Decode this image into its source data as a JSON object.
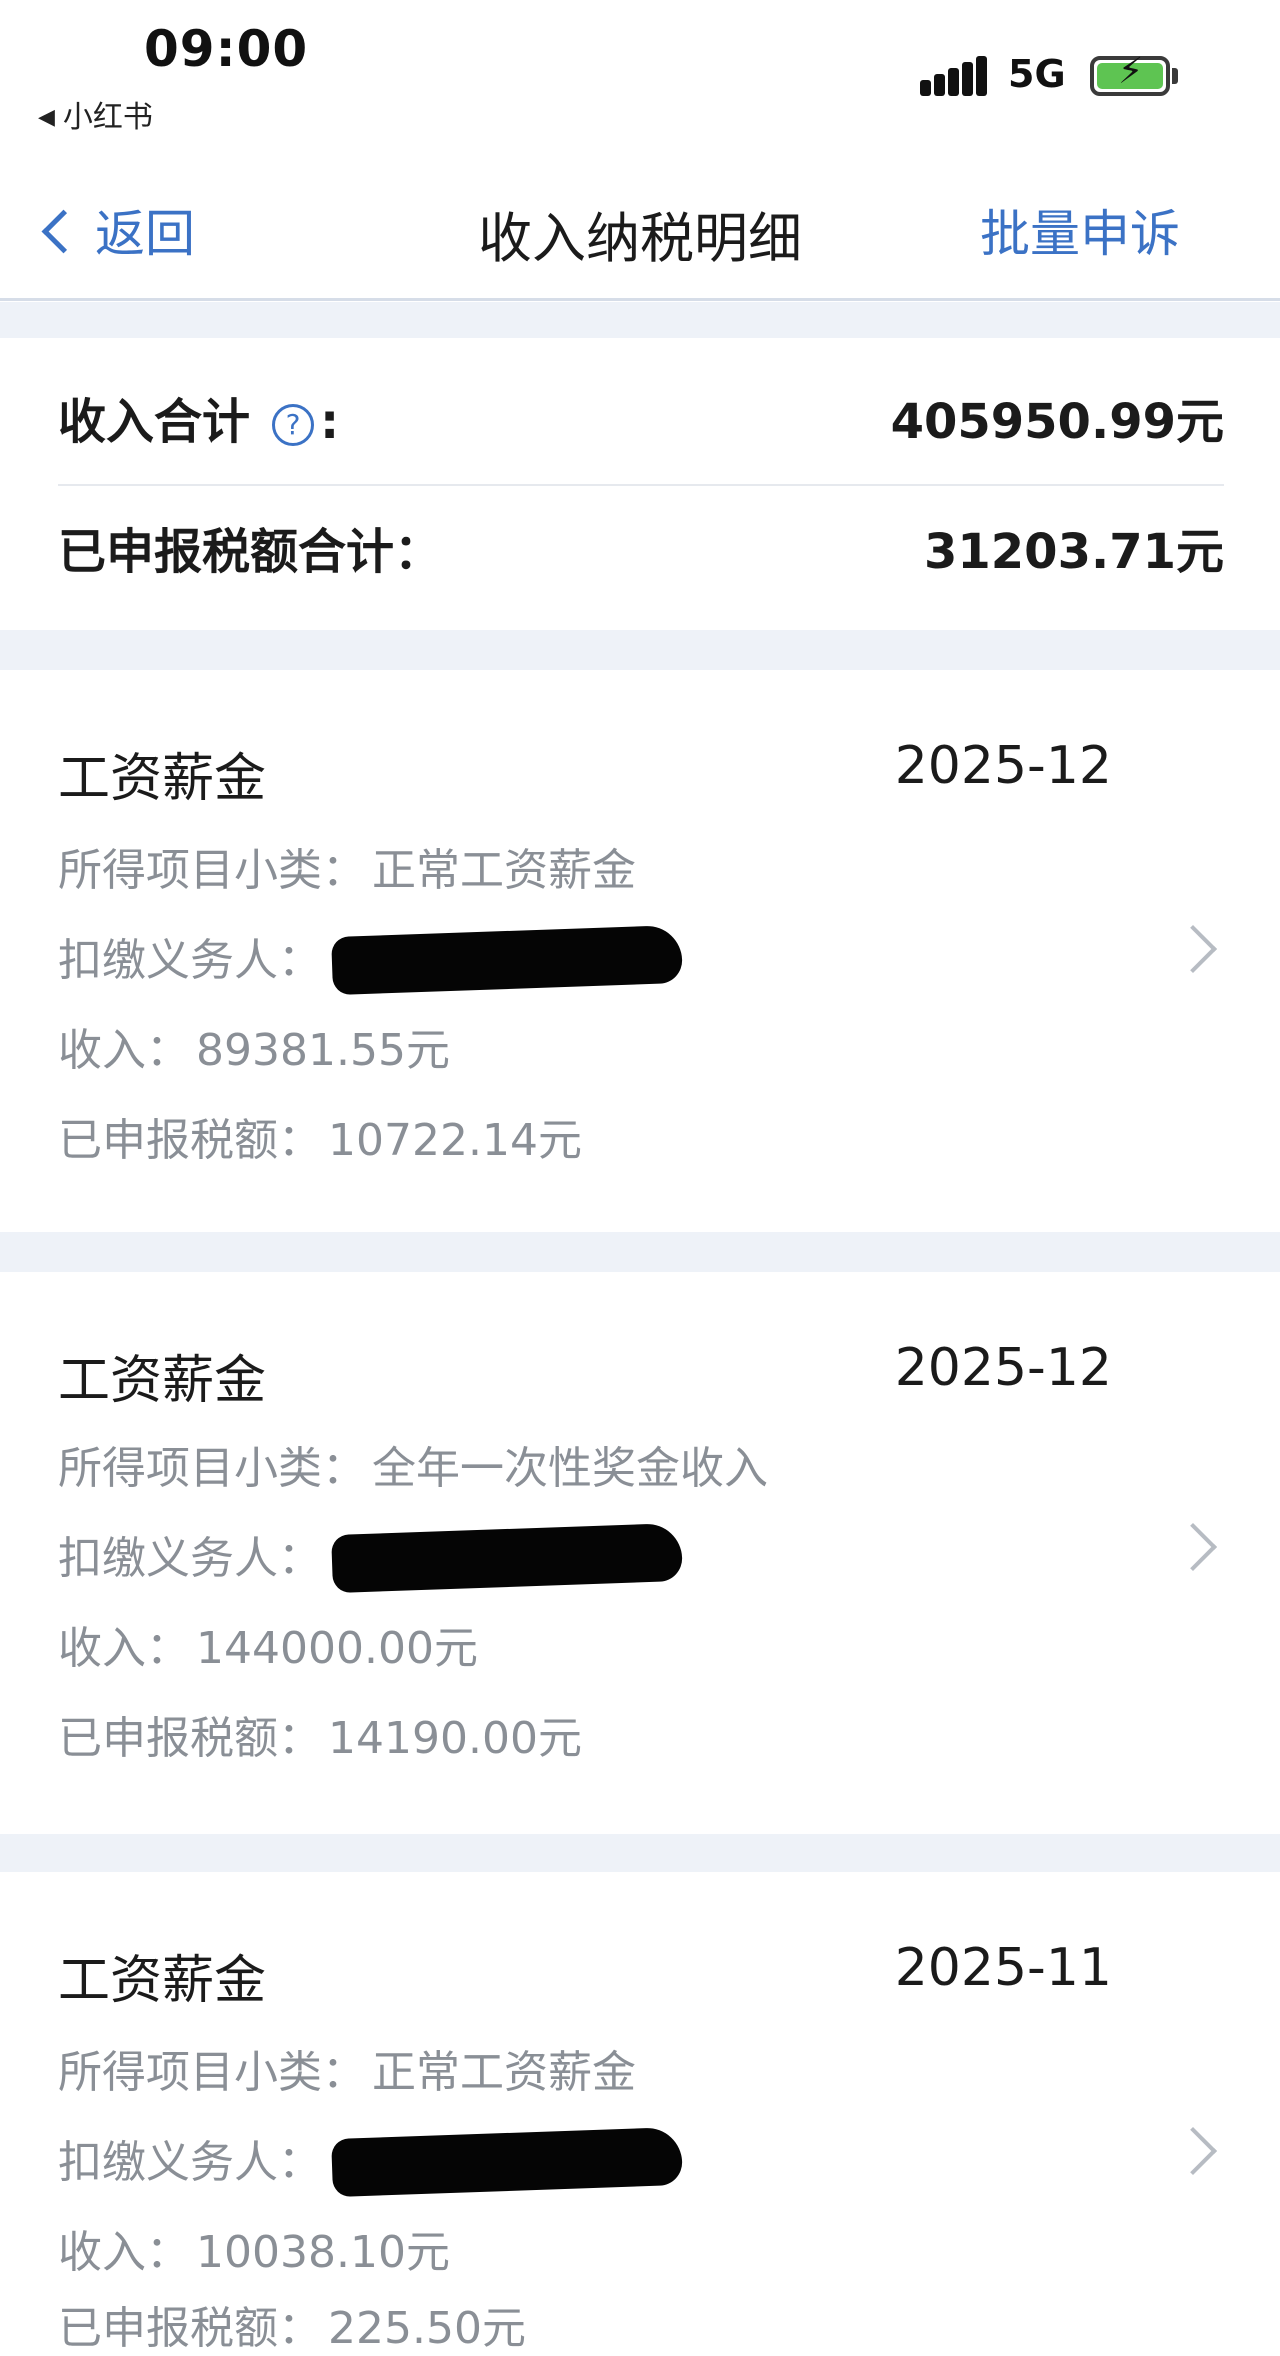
{
  "status_bar": {
    "time": "09:00",
    "back_app": "小红书",
    "network": "5G"
  },
  "nav": {
    "back_label": "返回",
    "title": "收入纳税明细",
    "action": "批量申诉"
  },
  "summary": {
    "income_label": "收入合计",
    "income_value": "405950.99元",
    "tax_label": "已申报税额合计：",
    "tax_value": "31203.71元"
  },
  "labels": {
    "subcategory": "所得项目小类：",
    "withholder": "扣缴义务人：",
    "income": "收入：",
    "tax": "已申报税额："
  },
  "records": [
    {
      "title": "工资薪金",
      "date": "2025-12",
      "subcategory": "正常工资薪金",
      "income": "89381.55元",
      "tax": "10722.14元"
    },
    {
      "title": "工资薪金",
      "date": "2025-12",
      "subcategory": "全年一次性奖金收入",
      "income": "144000.00元",
      "tax": "14190.00元"
    },
    {
      "title": "工资薪金",
      "date": "2025-11",
      "subcategory": "正常工资薪金",
      "income": "10038.10元",
      "tax": "225.50元"
    }
  ]
}
